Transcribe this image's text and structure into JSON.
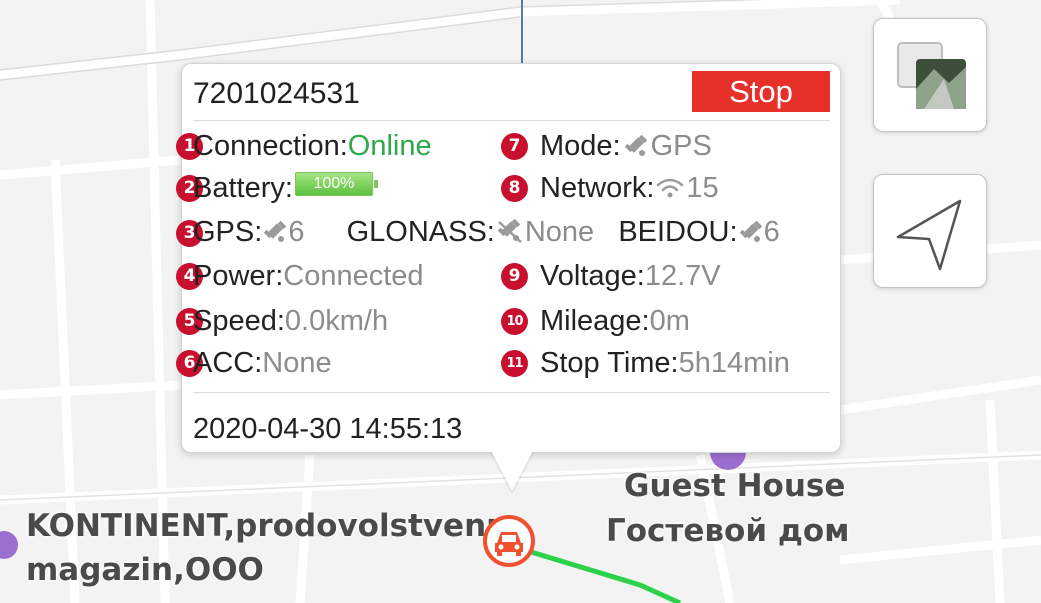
{
  "device": {
    "id": "7201024531",
    "stop_label": "Stop"
  },
  "status": {
    "connection": {
      "badge": "1",
      "label": "Connection:",
      "value": "Online"
    },
    "battery": {
      "badge": "2",
      "label": "Battery:",
      "value": "100%"
    },
    "satellites": {
      "badge": "3",
      "gps_label": "GPS:",
      "gps_value": "6",
      "glonass_label": "GLONASS:",
      "glonass_value": "None",
      "beidou_label": "BEIDOU:",
      "beidou_value": "6"
    },
    "power": {
      "badge": "4",
      "label": "Power:",
      "value": "Connected"
    },
    "speed": {
      "badge": "5",
      "label": "Speed:",
      "value": "0.0km/h"
    },
    "acc": {
      "badge": "6",
      "label": "ACC:",
      "value": "None"
    },
    "mode": {
      "badge": "7",
      "label": "Mode:",
      "value": "GPS"
    },
    "network": {
      "badge": "8",
      "label": "Network:",
      "value": "15"
    },
    "voltage": {
      "badge": "9",
      "label": "Voltage:",
      "value": "12.7V"
    },
    "mileage": {
      "badge": "10",
      "label": "Mileage:",
      "value": "0m"
    },
    "stop_time": {
      "badge": "11",
      "label": "Stop Time:",
      "value": "5h14min"
    }
  },
  "timestamp": "2020-04-30 14:55:13",
  "map": {
    "places": {
      "guest_house_en": "Guest House",
      "guest_house_ru": "Гостевой дом",
      "kontinent_line1": "KONTINENT,prodovolstvenn",
      "kontinent_line2": "magazin,OOO"
    }
  },
  "colors": {
    "accent_red": "#e8302a",
    "badge_red": "#c8102e",
    "online_green": "#2ea84a",
    "route_green": "#2ed24a",
    "marker_orange": "#f0522f"
  },
  "icons": [
    "layers-icon",
    "navigate-arrow-icon",
    "satellite-icon",
    "satellite-off-icon",
    "wifi-icon",
    "car-icon",
    "battery-icon"
  ]
}
